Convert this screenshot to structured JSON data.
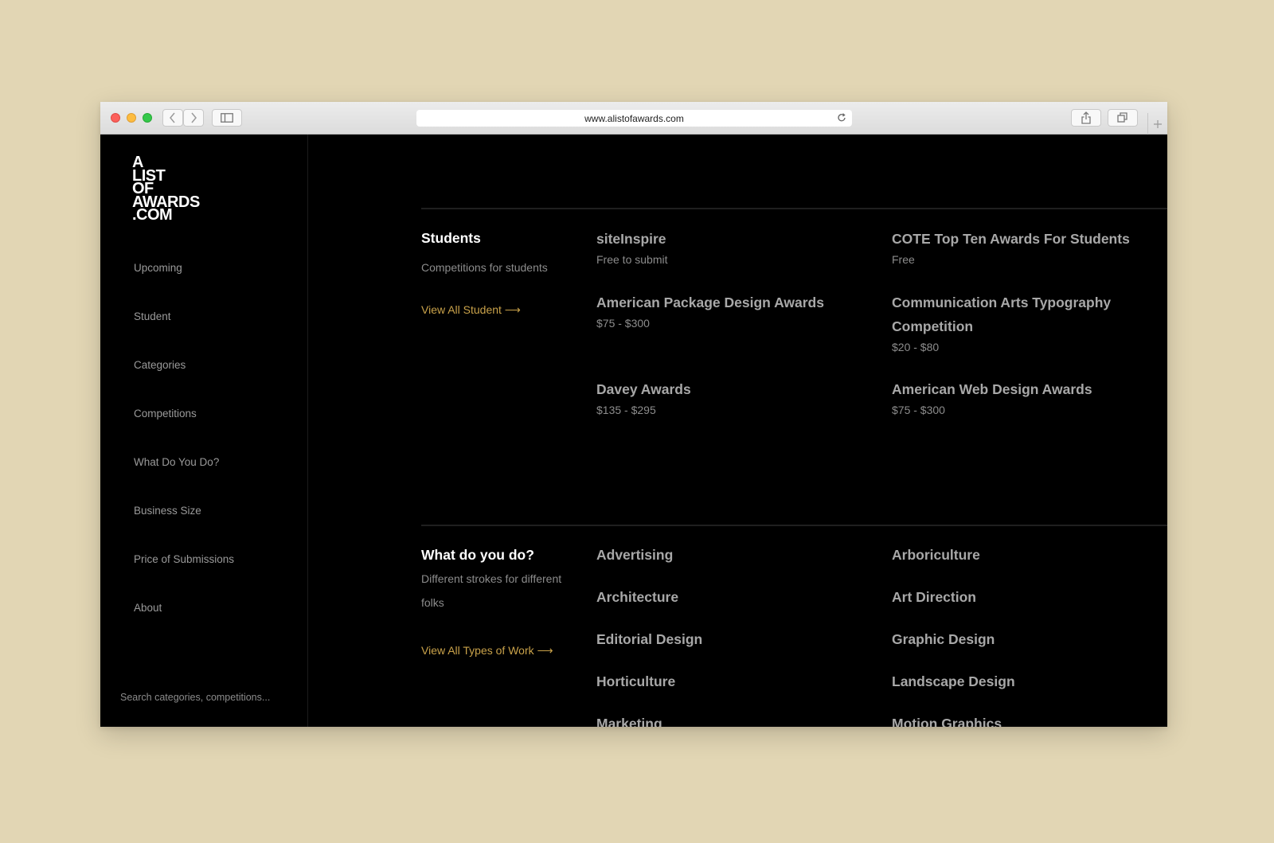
{
  "browser": {
    "url": "www.alistofawards.com"
  },
  "logo": [
    "A",
    "LIST",
    "OF",
    "AWARDS",
    ".COM"
  ],
  "nav": [
    {
      "label": "Upcoming"
    },
    {
      "label": "Student"
    },
    {
      "label": "Categories"
    },
    {
      "label": "Competitions"
    },
    {
      "label": "What Do You Do?"
    },
    {
      "label": "Business Size"
    },
    {
      "label": "Price of Submissions"
    },
    {
      "label": "About"
    }
  ],
  "search": {
    "placeholder": "Search categories, competitions..."
  },
  "students": {
    "title": "Students",
    "description": "Competitions for students",
    "link": "View All Student ⟶",
    "items": [
      {
        "title": "siteInspire",
        "sub": "Free to submit"
      },
      {
        "title": "COTE Top Ten Awards For Students",
        "sub": "Free"
      },
      {
        "title": "American Package Design Awards",
        "sub": "$75 - $300"
      },
      {
        "title": "Communication Arts Typography Competition",
        "sub": "$20 - $80"
      },
      {
        "title": "Davey Awards",
        "sub": "$135 - $295"
      },
      {
        "title": "American Web Design Awards",
        "sub": "$75 - $300"
      }
    ]
  },
  "work": {
    "title": "What do you do?",
    "description": "Different strokes for different folks",
    "link": "View All Types of Work ⟶",
    "categories": [
      "Advertising",
      "Arboriculture",
      "Architecture",
      "Art Direction",
      "Editorial Design",
      "Graphic Design",
      "Horticulture",
      "Landscape Design",
      "Marketing",
      "Motion Graphics"
    ]
  }
}
